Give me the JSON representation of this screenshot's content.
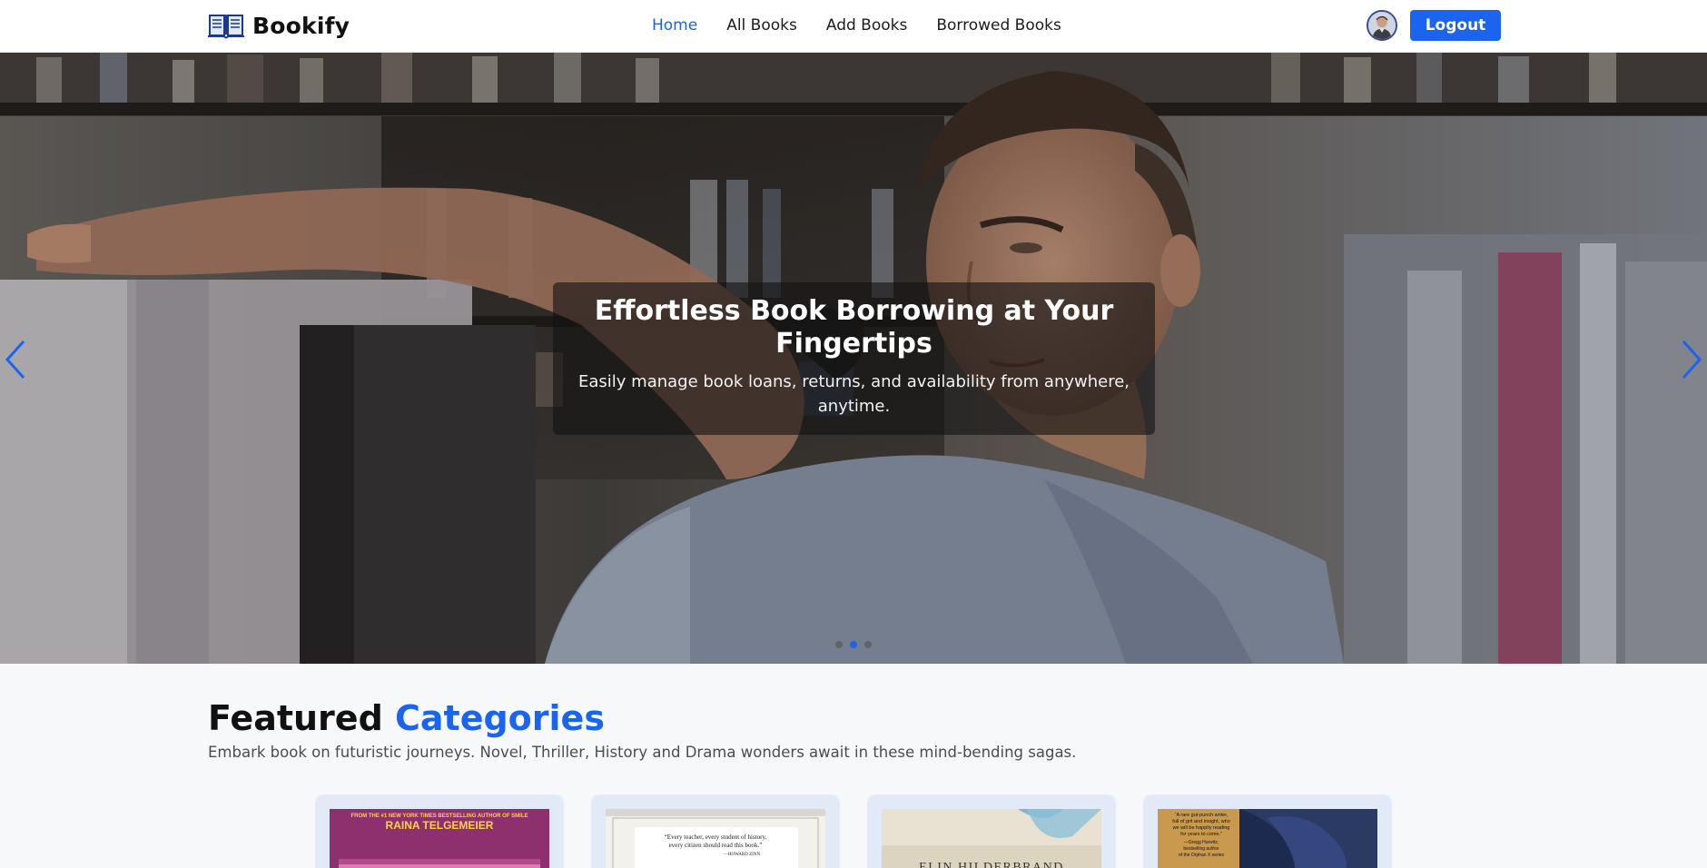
{
  "brand": {
    "name": "Bookify",
    "icon": "open-book-icon"
  },
  "nav": {
    "links": [
      {
        "label": "Home",
        "active": true
      },
      {
        "label": "All Books",
        "active": false
      },
      {
        "label": "Add Books",
        "active": false
      },
      {
        "label": "Borrowed Books",
        "active": false
      }
    ]
  },
  "user": {
    "avatar_icon": "user-avatar",
    "logout_label": "Logout"
  },
  "hero": {
    "title": "Effortless Book Borrowing at Your Fingertips",
    "subtitle": "Easily manage book loans, returns, and availability from anywhere, anytime.",
    "prev_icon": "chevron-left-icon",
    "next_icon": "chevron-right-icon",
    "slide_count": 3,
    "active_slide": 2
  },
  "featured": {
    "heading_plain": "Featured",
    "heading_accent": "Categories",
    "description": "Embark book on futuristic journeys. Novel, Thriller, History and Drama wonders await in these mind-bending sagas.",
    "cards": [
      {
        "cover_top_text": "FROM THE #1 NEW YORK TIMES BESTSELLING AUTHOR OF SMILE",
        "cover_author": "RAINA TELGEMEIER",
        "cover_color": "#8e2f6e"
      },
      {
        "cover_quote": "“Every teacher, every student of history, every citizen should read this book.”",
        "cover_quote_by": "—HOWARD ZINN",
        "cover_color": "#f3f1ec"
      },
      {
        "cover_author": "ELIN HILDERBRAND",
        "cover_color": "#dcd3c0"
      },
      {
        "cover_quote": "“A rare gut-punch writer, full of grit and insight, who we will be happily reading for years to come.” —Gregg Hurwitz, bestselling author of the Orphan X series",
        "cover_color": "#2b3a63"
      }
    ]
  },
  "colors": {
    "accent": "#1b64f0",
    "nav_active": "#1e63d8",
    "card_bg": "#e2eaf8"
  }
}
